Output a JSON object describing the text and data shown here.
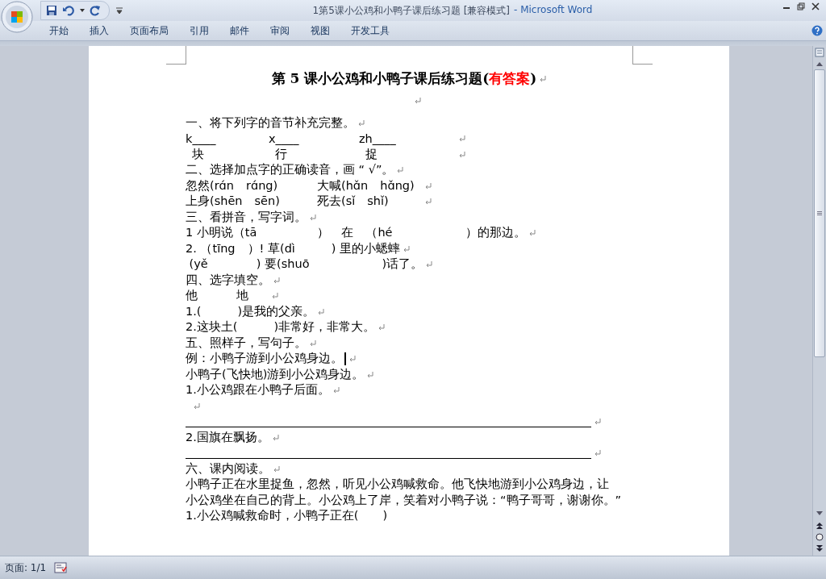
{
  "window": {
    "title": "1第5课小公鸡和小鸭子课后练习题 [兼容模式]",
    "app": "- Microsoft Word"
  },
  "ribbon_tabs": [
    {
      "label": "开始",
      "selected": false
    },
    {
      "label": "插入",
      "selected": false
    },
    {
      "label": "页面布局",
      "selected": false
    },
    {
      "label": "引用",
      "selected": false
    },
    {
      "label": "邮件",
      "selected": false
    },
    {
      "label": "审阅",
      "selected": false
    },
    {
      "label": "视图",
      "selected": false
    },
    {
      "label": "开发工具",
      "selected": false
    }
  ],
  "document": {
    "title": [
      {
        "text": "第 5 课小公鸡和小鸭子课后练习题(",
        "color": "#000000"
      },
      {
        "text": "有答案",
        "color": "#ff0000"
      },
      {
        "text": ")",
        "color": "#000000"
      }
    ],
    "lines": [
      {
        "kind": "blank",
        "mark": true,
        "caret": false
      },
      {
        "kind": "text",
        "segments": [
          "一、将下列字的音节补充完整。"
        ],
        "mark": true,
        "caret": false
      },
      {
        "kind": "columns",
        "segments": [
          "k____",
          "x____",
          "zh____"
        ],
        "mark": true,
        "caret": false
      },
      {
        "kind": "columns",
        "segments": [
          "块",
          "行",
          "捉"
        ],
        "mark": true,
        "caret": false
      },
      {
        "kind": "text",
        "segments": [
          "二、选择加点字的正确读音，画 “ √”。"
        ],
        "mark": true,
        "caret": false
      },
      {
        "kind": "pair",
        "segments": [
          "忽然(rɑ́n　rɑ́ng)",
          "大喊(hɑ̌n　hɑ̌ng)"
        ],
        "mark": true,
        "caret": false
      },
      {
        "kind": "pair",
        "segments": [
          "上身(shēn　sēn)",
          "死去(sǐ　shǐ)"
        ],
        "mark": true,
        "caret": false
      },
      {
        "kind": "text",
        "segments": [
          "三、看拼音，写字词。"
        ],
        "mark": true,
        "caret": false
      },
      {
        "kind": "text",
        "segments": [
          "1 小明说（tā　　　　　）　在　（hé　　　　　　）的那边。"
        ],
        "mark": true,
        "caret": false
      },
      {
        "kind": "text",
        "segments": [
          "2. （tīng　）! 草(dì　　　) 里的小蟋蟀"
        ],
        "mark": true,
        "caret": false
      },
      {
        "kind": "text",
        "segments": [
          " (yě　　　　) 要(shuō　　　　　　)话了。"
        ],
        "mark": true,
        "caret": false
      },
      {
        "kind": "text",
        "segments": [
          "四、选字填空。"
        ],
        "mark": true,
        "caret": false
      },
      {
        "kind": "short_pair",
        "segments": [
          "他",
          "地"
        ],
        "mark": true,
        "caret": false
      },
      {
        "kind": "text",
        "segments": [
          "1.(　　　)是我的父亲。"
        ],
        "mark": true,
        "caret": false
      },
      {
        "kind": "text",
        "segments": [
          "2.这块土(　　　)非常好，非常大。"
        ],
        "mark": true,
        "caret": false
      },
      {
        "kind": "text",
        "segments": [
          "五、照样子，写句子。"
        ],
        "mark": true,
        "caret": false
      },
      {
        "kind": "text",
        "segments": [
          "例：小鸭子游到小公鸡身边。"
        ],
        "mark": true,
        "caret": true
      },
      {
        "kind": "text",
        "segments": [
          "小鸭子(飞快地)游到小公鸡身边。"
        ],
        "mark": true,
        "caret": false
      },
      {
        "kind": "text",
        "segments": [
          "1.小公鸡跟在小鸭子后面。"
        ],
        "mark": true,
        "caret": false
      },
      {
        "kind": "blank",
        "mark": true,
        "caret": false
      },
      {
        "kind": "rule",
        "mark": true,
        "caret": false
      },
      {
        "kind": "text",
        "segments": [
          "2.国旗在飘扬。"
        ],
        "mark": true,
        "caret": false
      },
      {
        "kind": "rule",
        "mark": true,
        "caret": false
      },
      {
        "kind": "text",
        "segments": [
          "六、课内阅读。"
        ],
        "mark": true,
        "caret": false
      },
      {
        "kind": "text",
        "segments": [
          "小鸭子正在水里捉鱼，忽然，听见小公鸡喊救命。他飞快地游到小公鸡身边，让"
        ],
        "mark": false,
        "caret": false
      },
      {
        "kind": "text",
        "segments": [
          "小公鸡坐在自己的背上。小公鸡上了岸，笑着对小鸭子说：“鸭子哥哥，谢谢你。”"
        ],
        "mark": false,
        "caret": false
      },
      {
        "kind": "text",
        "segments": [
          "1.小公鸡喊救命时，小鸭子正在(　　)"
        ],
        "mark": false,
        "caret": false
      }
    ]
  },
  "status_bar": {
    "page": "页面: 1/1"
  }
}
